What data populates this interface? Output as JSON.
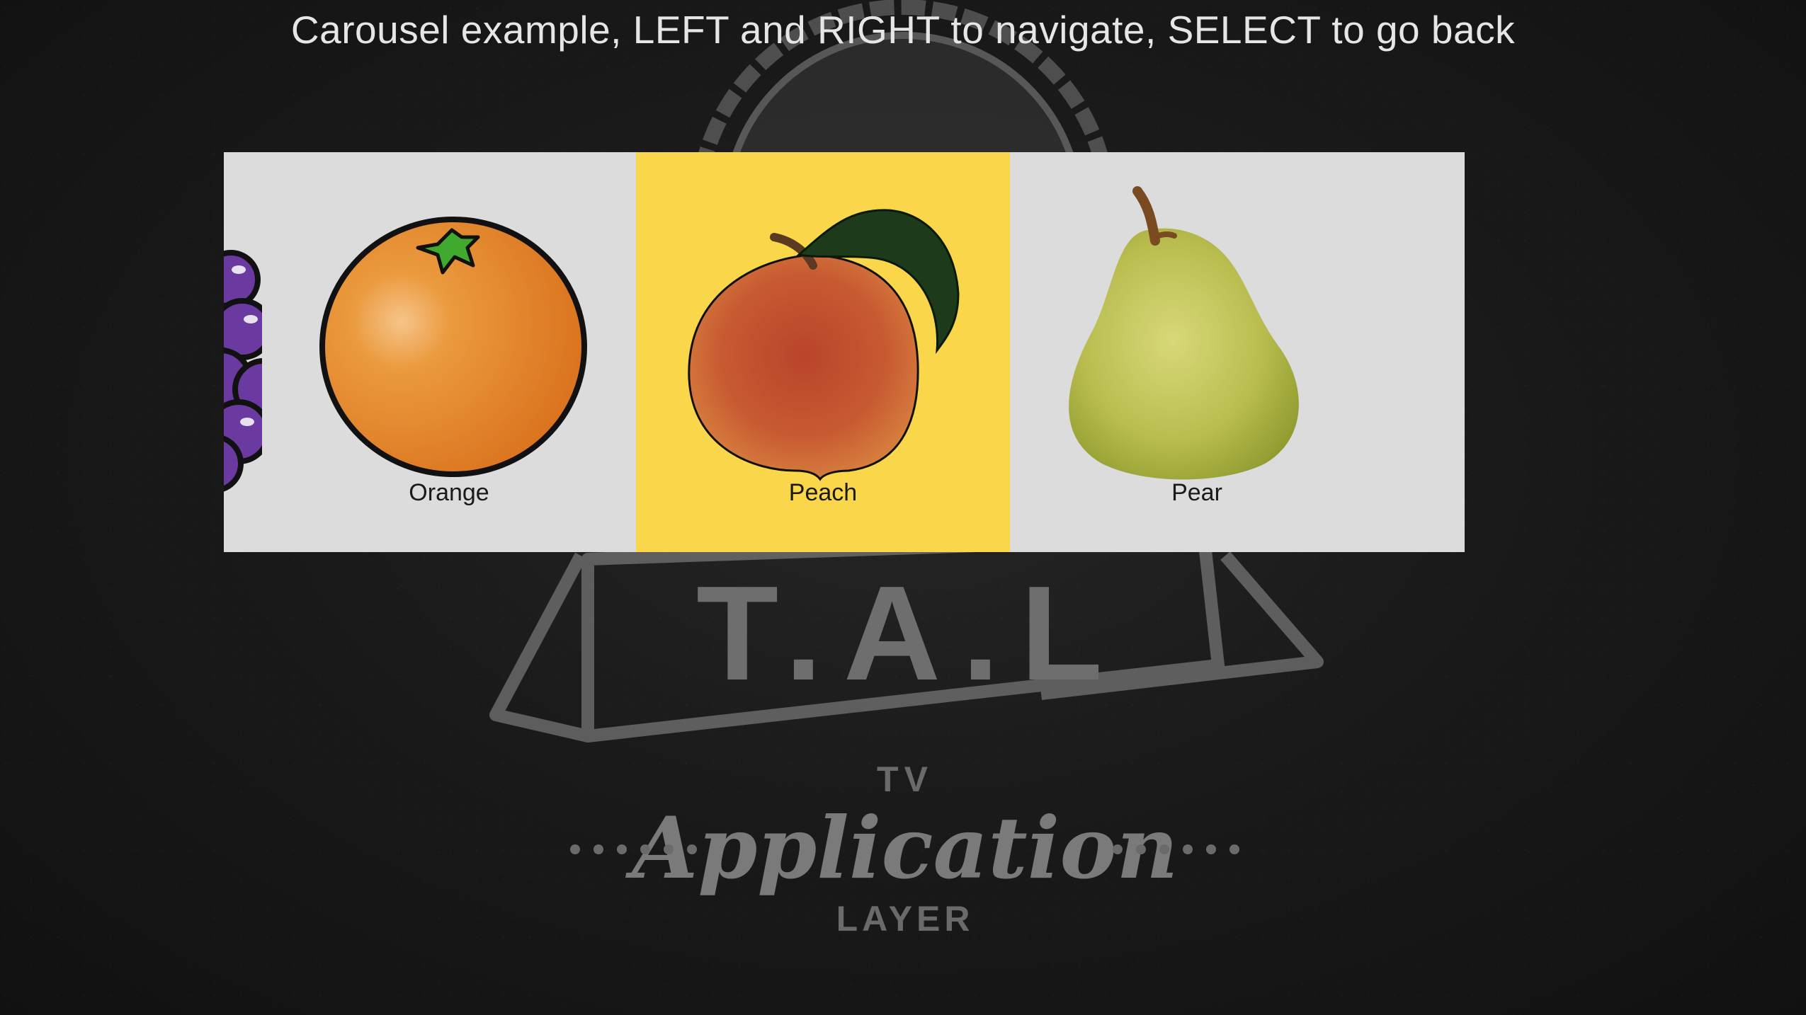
{
  "instructions": "Carousel example, LEFT and RIGHT to navigate, SELECT to go back",
  "background_logo": {
    "badge_text": "T.A.L",
    "line1": "TV",
    "line2": "Application",
    "line3": "LAYER"
  },
  "carousel": {
    "selected_index": 2,
    "items": [
      {
        "label": "",
        "icon": "grapes-icon"
      },
      {
        "label": "Orange",
        "icon": "orange-icon"
      },
      {
        "label": "Peach",
        "icon": "peach-icon"
      },
      {
        "label": "Pear",
        "icon": "pear-icon"
      }
    ]
  },
  "colors": {
    "background": "#151515",
    "carousel_item": "#dcdcdc",
    "selected_item": "#fad74a",
    "instruction_text": "#e6e6e6",
    "label_text": "#1a1a1a"
  }
}
